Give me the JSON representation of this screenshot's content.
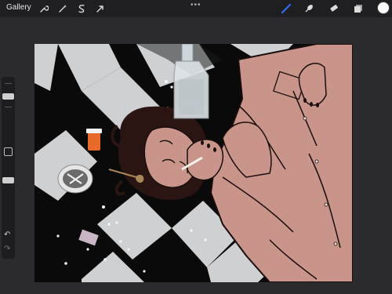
{
  "toolbar": {
    "gallery_label": "Gallery",
    "left_tools": [
      "wrench-icon",
      "magic-wand-icon",
      "selection-icon",
      "transform-arrow-icon"
    ],
    "right_tools": [
      "brush-icon",
      "smudge-icon",
      "eraser-icon",
      "layers-icon"
    ],
    "active_tool": "brush-icon",
    "active_color": "#ffffff",
    "accent": "#2f6fff"
  },
  "sidebar": {
    "size_slider_level": 0.16,
    "opacity_slider_level": 0.65
  },
  "artwork": {
    "skin_color": "#c9958b",
    "shirt_color": "#c9958b",
    "outline_color": "#1a0e0c",
    "tile_light": "#d6d6d6",
    "tile_dark": "#0a0a0a"
  }
}
